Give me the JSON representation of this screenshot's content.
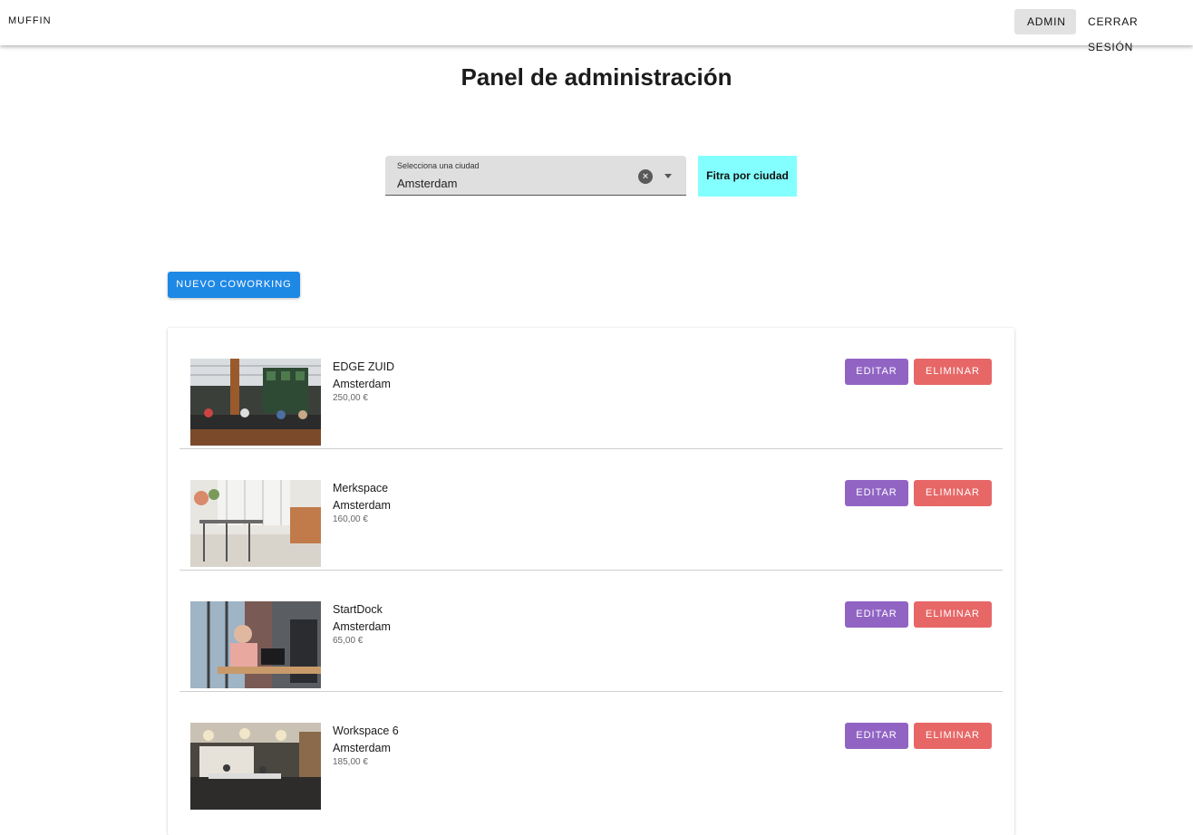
{
  "appbar": {
    "brand": "MUFFIN",
    "admin_label": "ADMIN",
    "logout_label": "CERRAR SESIÓN"
  },
  "page": {
    "title": "Panel de administración"
  },
  "filter": {
    "select_label": "Selecciona una ciudad",
    "select_value": "Amsterdam",
    "button_label": "Fitra por ciudad"
  },
  "actions": {
    "new_label": "NUEVO COWORKING"
  },
  "coworkings": [
    {
      "name": "EDGE ZUID",
      "city": "Amsterdam",
      "price": "250,00 €",
      "edit_label": "EDITAR",
      "delete_label": "ELIMINAR"
    },
    {
      "name": "Merkspace",
      "city": "Amsterdam",
      "price": "160,00 €",
      "edit_label": "EDITAR",
      "delete_label": "ELIMINAR"
    },
    {
      "name": "StartDock",
      "city": "Amsterdam",
      "price": "65,00 €",
      "edit_label": "EDITAR",
      "delete_label": "ELIMINAR"
    },
    {
      "name": "Workspace 6",
      "city": "Amsterdam",
      "price": "185,00 €",
      "edit_label": "EDITAR",
      "delete_label": "ELIMINAR"
    }
  ],
  "colors": {
    "new_button": "#1e88e5",
    "filter_button": "#84ffff",
    "edit_button": "#9164c4",
    "delete_button": "#e76767"
  }
}
